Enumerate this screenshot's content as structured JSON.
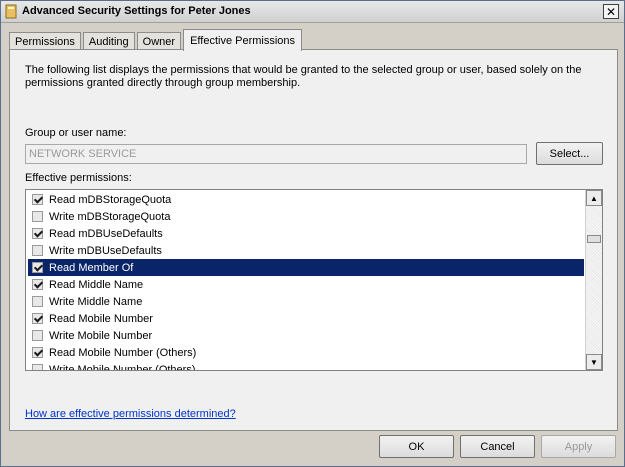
{
  "window": {
    "title": "Advanced Security Settings for Peter Jones",
    "close_label": "✕"
  },
  "tabs": [
    {
      "label": "Permissions",
      "active": false
    },
    {
      "label": "Auditing",
      "active": false
    },
    {
      "label": "Owner",
      "active": false
    },
    {
      "label": "Effective Permissions",
      "active": true
    }
  ],
  "panel": {
    "description": "The following list displays the permissions that would be granted to the selected group or user, based solely on the permissions granted directly through group membership.",
    "group_label": "Group or user name:",
    "group_value": "NETWORK SERVICE",
    "select_label": "Select...",
    "perms_label": "Effective permissions:",
    "help_link": "How are effective permissions determined?"
  },
  "permissions": [
    {
      "label": "Read mDBStorageQuota",
      "checked": true,
      "selected": false
    },
    {
      "label": "Write mDBStorageQuota",
      "checked": false,
      "selected": false
    },
    {
      "label": "Read mDBUseDefaults",
      "checked": true,
      "selected": false
    },
    {
      "label": "Write mDBUseDefaults",
      "checked": false,
      "selected": false
    },
    {
      "label": "Read Member Of",
      "checked": true,
      "selected": true
    },
    {
      "label": "Read Middle Name",
      "checked": true,
      "selected": false
    },
    {
      "label": "Write Middle Name",
      "checked": false,
      "selected": false
    },
    {
      "label": "Read Mobile Number",
      "checked": true,
      "selected": false
    },
    {
      "label": "Write Mobile Number",
      "checked": false,
      "selected": false
    },
    {
      "label": "Read Mobile Number (Others)",
      "checked": true,
      "selected": false
    },
    {
      "label": "Write Mobile Number (Others)",
      "checked": false,
      "selected": false
    }
  ],
  "footer": {
    "ok_label": "OK",
    "cancel_label": "Cancel",
    "apply_label": "Apply"
  },
  "colors": {
    "selection": "#0a246a",
    "link": "#0033cc"
  }
}
